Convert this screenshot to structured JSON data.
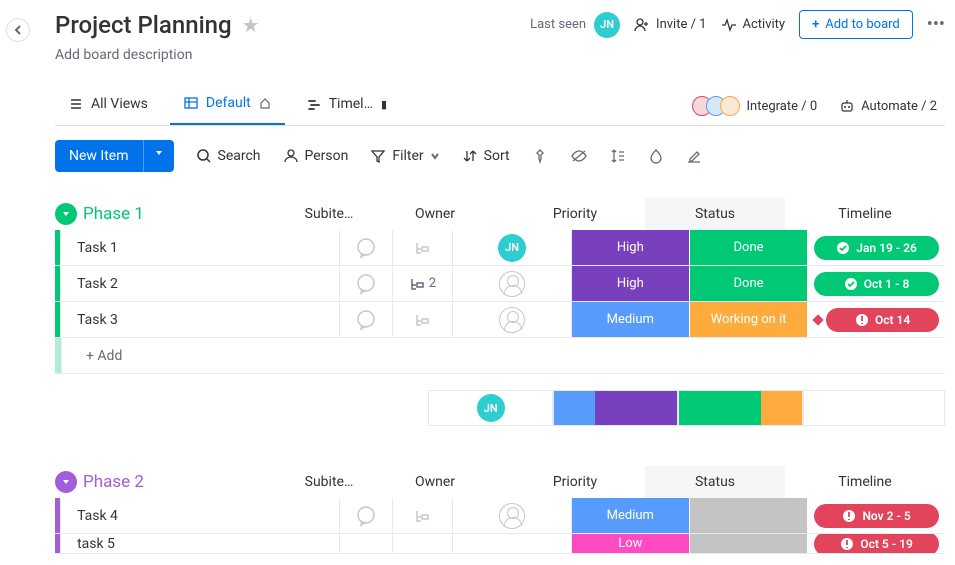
{
  "header": {
    "title": "Project Planning",
    "description": "Add board description",
    "last_seen_label": "Last seen",
    "user_initials": "JN",
    "invite_label": "Invite / 1",
    "activity_label": "Activity",
    "add_to_board_label": "Add to board"
  },
  "tabs": {
    "all_views": "All Views",
    "default": "Default",
    "timeline": "Timel…",
    "integrate": "Integrate / 0",
    "automate": "Automate / 2"
  },
  "toolbar": {
    "new_item": "New Item",
    "search": "Search",
    "person": "Person",
    "filter": "Filter",
    "sort": "Sort"
  },
  "columns": {
    "subitems": "Subite…",
    "owner": "Owner",
    "priority": "Priority",
    "status": "Status",
    "timeline": "Timeline"
  },
  "colors": {
    "blue": "#0073ea",
    "green_group": "#00c875",
    "purple_group": "#a25ddc",
    "high": "#7840bf",
    "medium": "#579bfc",
    "low": "#ff4ac4",
    "done": "#00c875",
    "working": "#fdab3d",
    "grey": "#c4c4c4",
    "timeline_green": "#00c875",
    "timeline_red": "#e2445c"
  },
  "groups": [
    {
      "name": "Phase 1",
      "color": "#00c875",
      "rows": [
        {
          "name": "Task 1",
          "owner": "JN",
          "subitems": "",
          "priority": "High",
          "priority_color": "#7840bf",
          "status": "Done",
          "status_color": "#00c875",
          "timeline": "Jan 19 - 26",
          "timeline_color": "#00c875",
          "timeline_icon": "check"
        },
        {
          "name": "Task 2",
          "owner": "",
          "subitems": "2",
          "priority": "High",
          "priority_color": "#7840bf",
          "status": "Done",
          "status_color": "#00c875",
          "timeline": "Oct 1 - 8",
          "timeline_color": "#00c875",
          "timeline_icon": "check"
        },
        {
          "name": "Task 3",
          "owner": "",
          "subitems": "",
          "priority": "Medium",
          "priority_color": "#579bfc",
          "status": "Working on it",
          "status_color": "#fdab3d",
          "timeline": "Oct 14",
          "timeline_color": "#e2445c",
          "timeline_icon": "warn",
          "diamond": true
        }
      ],
      "add_label": "+ Add",
      "summary_owner": "JN",
      "summary_priority": [
        {
          "c": "#579bfc",
          "w": 33
        },
        {
          "c": "#7840bf",
          "w": 67
        }
      ],
      "summary_status": [
        {
          "c": "#00c875",
          "w": 67
        },
        {
          "c": "#fdab3d",
          "w": 33
        }
      ]
    },
    {
      "name": "Phase 2",
      "color": "#a25ddc",
      "rows": [
        {
          "name": "Task 4",
          "owner": "",
          "subitems": "",
          "priority": "Medium",
          "priority_color": "#579bfc",
          "status": "",
          "status_color": "#c4c4c4",
          "timeline": "Nov 2 - 5",
          "timeline_color": "#e2445c",
          "timeline_icon": "warn"
        },
        {
          "name": "task 5",
          "owner": "",
          "subitems": "",
          "priority": "Low",
          "priority_color": "#ff4ac4",
          "status": "",
          "status_color": "#c4c4c4",
          "timeline": "Oct 5 - 19",
          "timeline_color": "#e2445c",
          "timeline_icon": "warn"
        }
      ]
    }
  ]
}
